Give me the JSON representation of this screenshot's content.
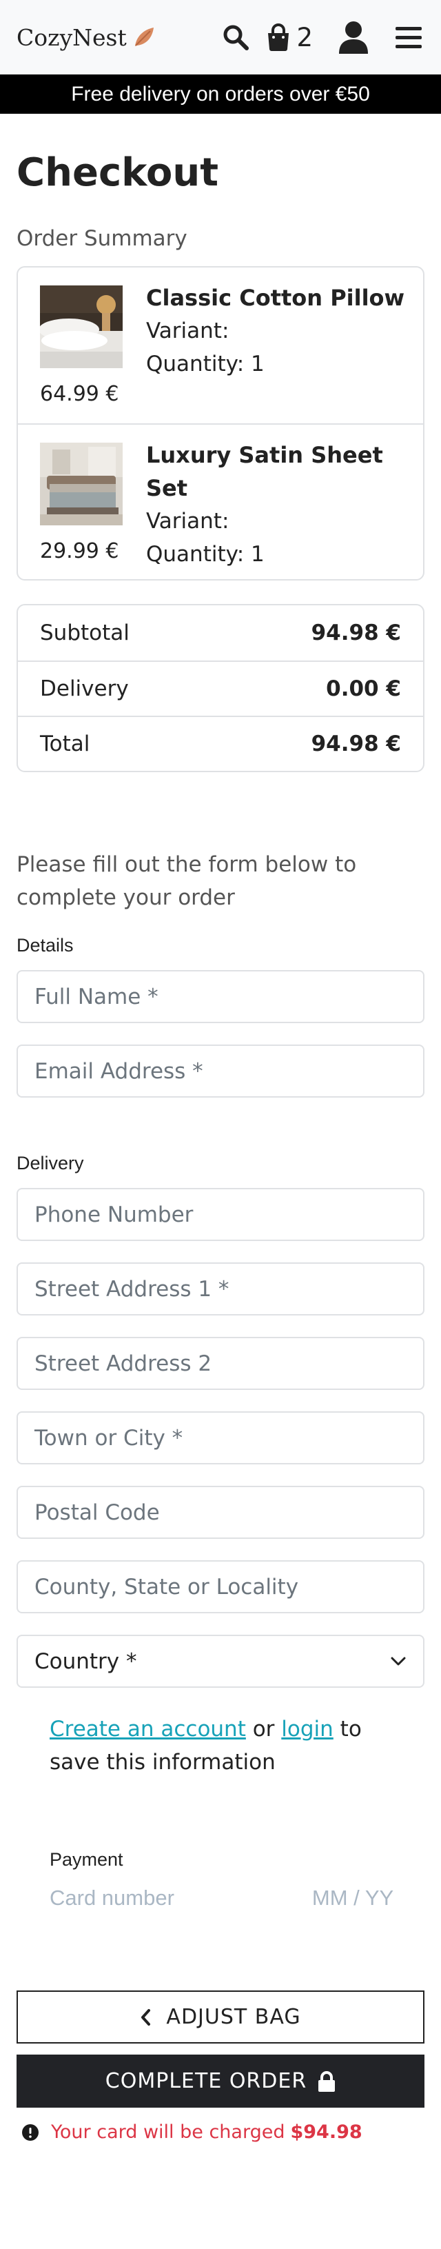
{
  "header": {
    "logo_text": "CozyNest",
    "bag_count": "2",
    "icons": [
      "leaf-icon",
      "search-icon",
      "shopping-bag-icon",
      "user-icon",
      "menu-icon"
    ]
  },
  "banner": {
    "text": "Free delivery on orders over €50"
  },
  "page": {
    "title": "Checkout"
  },
  "order_summary": {
    "label": "Order Summary",
    "items": [
      {
        "name": "Classic Cotton Pillow",
        "variant": "Variant:",
        "quantity": "Quantity: 1",
        "price": "64.99 €"
      },
      {
        "name": "Luxury Satin Sheet Set",
        "variant": "Variant:",
        "quantity": "Quantity: 1",
        "price": "29.99 €"
      }
    ]
  },
  "totals": {
    "subtotal_label": "Subtotal",
    "subtotal_value": "94.98 €",
    "delivery_label": "Delivery",
    "delivery_value": "0.00 €",
    "total_label": "Total",
    "total_value": "94.98 €"
  },
  "form": {
    "intro": "Please fill out the form below to complete your order",
    "details_label": "Details",
    "full_name_placeholder": "Full Name *",
    "email_placeholder": "Email Address *",
    "delivery_label": "Delivery",
    "phone_placeholder": "Phone Number",
    "street1_placeholder": "Street Address 1 *",
    "street2_placeholder": "Street Address 2",
    "town_placeholder": "Town or City *",
    "postal_placeholder": "Postal Code",
    "county_placeholder": "County, State or Locality",
    "country_selected": "Country *",
    "save_create_link": "Create an account",
    "save_or": " or ",
    "save_login_link": "login",
    "save_suffix": " to save this information"
  },
  "payment": {
    "label": "Payment",
    "card_number_placeholder": "Card number",
    "expiry_placeholder": "MM / YY"
  },
  "actions": {
    "adjust_bag": "ADJUST BAG",
    "complete_order": "COMPLETE ORDER",
    "charge_text": "Your card will be charged",
    "charge_amount": "$94.98"
  },
  "colors": {
    "banner_bg": "#000000",
    "link": "#17a2b8",
    "danger": "#dc3545",
    "button_dark": "#222327"
  }
}
